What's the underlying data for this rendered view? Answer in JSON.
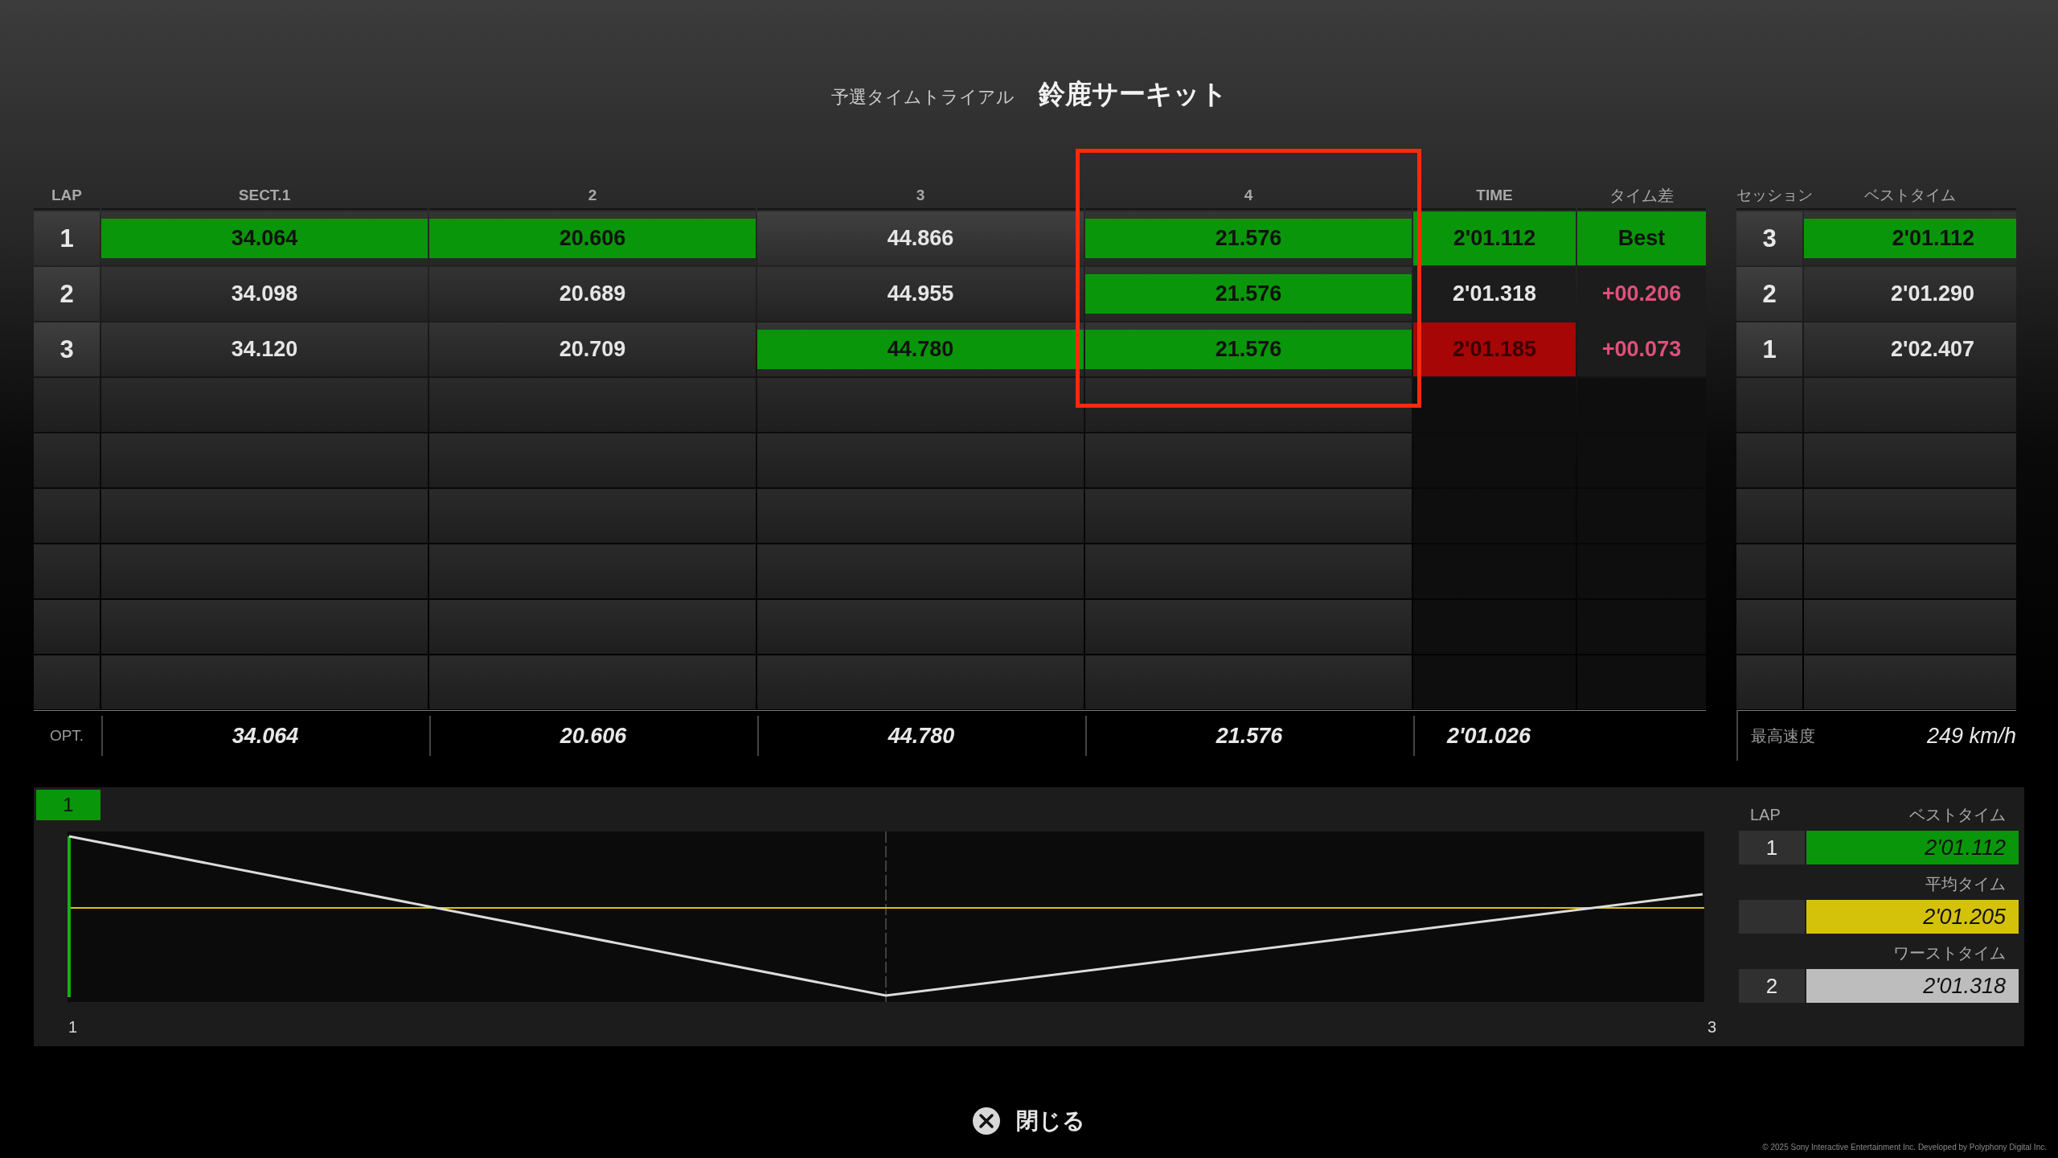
{
  "header": {
    "subtitle": "予選タイムトライアル",
    "circuit": "鈴鹿サーキット"
  },
  "lap_table": {
    "columns": [
      {
        "label": "LAP",
        "highlighted": false
      },
      {
        "label": "SECT.1",
        "highlighted": false
      },
      {
        "label": "2",
        "highlighted": false
      },
      {
        "label": "3",
        "highlighted": false
      },
      {
        "label": "4",
        "highlighted": true
      },
      {
        "label": "TIME",
        "highlighted": false
      },
      {
        "label": "タイム差",
        "highlighted": false
      }
    ],
    "rows": [
      {
        "cells": [
          {
            "text": "1"
          },
          {
            "text": "34.064",
            "best": true,
            "flagged": false
          },
          {
            "text": "20.606",
            "best": true,
            "flagged": false
          },
          {
            "text": "44.866",
            "best": false,
            "flagged": false
          },
          {
            "text": "21.576",
            "best": true,
            "flagged": false
          },
          {
            "text": "2'01.112",
            "best": true,
            "flagged": false
          },
          {
            "text": "Best",
            "best": true,
            "flagged": false
          }
        ]
      },
      {
        "cells": [
          {
            "text": "2"
          },
          {
            "text": "34.098",
            "best": false,
            "flagged": false
          },
          {
            "text": "20.689",
            "best": false,
            "flagged": false
          },
          {
            "text": "44.955",
            "best": false,
            "flagged": false
          },
          {
            "text": "21.576",
            "best": true,
            "flagged": false
          },
          {
            "text": "2'01.318",
            "best": false,
            "flagged": false
          },
          {
            "text": "+00.206",
            "best": false,
            "flagged": false
          }
        ]
      },
      {
        "cells": [
          {
            "text": "3"
          },
          {
            "text": "34.120",
            "best": false,
            "flagged": false
          },
          {
            "text": "20.709",
            "best": false,
            "flagged": false
          },
          {
            "text": "44.780",
            "best": true,
            "flagged": false
          },
          {
            "text": "21.576",
            "best": true,
            "flagged": false
          },
          {
            "text": "2'01.185",
            "best": false,
            "flagged": true
          },
          {
            "text": "+00.073",
            "best": false,
            "flagged": false
          }
        ]
      }
    ],
    "optimal": {
      "label": "OPT.",
      "values": [
        "34.064",
        "20.606",
        "44.780",
        "21.576",
        "2'01.026"
      ]
    }
  },
  "session_table": {
    "columns": [
      "セッション",
      "ベストタイム"
    ],
    "rows": [
      {
        "session": "3",
        "time": "2'01.112",
        "best": true
      },
      {
        "session": "2",
        "time": "2'01.290",
        "best": false
      },
      {
        "session": "1",
        "time": "2'02.407",
        "best": false
      }
    ],
    "top_speed": {
      "label": "最高速度",
      "value": "249 km/h"
    }
  },
  "chart": {
    "tab": {
      "label": "1",
      "selected": true
    },
    "x_labels": [
      "1",
      "3"
    ],
    "legend": {
      "lap_header": "LAP",
      "entries": [
        {
          "title": "ベストタイム",
          "lap": "1",
          "time": "2'01.112",
          "color": "#0a960a"
        },
        {
          "title": "平均タイム",
          "time": "2'01.205",
          "color": "#d4c20a"
        },
        {
          "title": "ワーストタイム",
          "lap": "2",
          "time": "2'01.318",
          "color": "#bdbdbd"
        }
      ]
    }
  },
  "close_button": {
    "label": "閉じる"
  },
  "copyright": "© 2025 Sony Interactive Entertainment Inc. Developed by Polyphony Digital Inc."
}
